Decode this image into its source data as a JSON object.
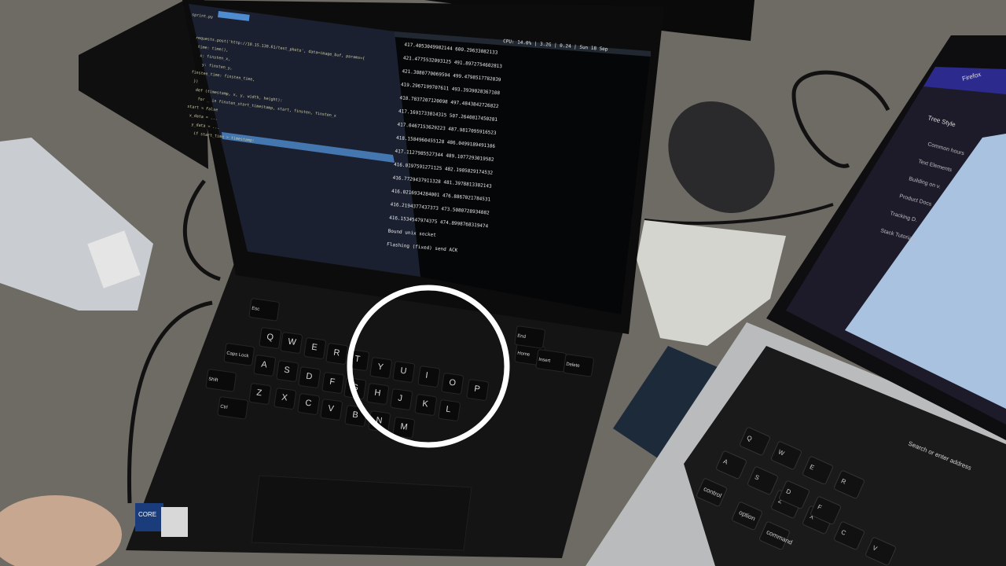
{
  "scene": {
    "description_label": "Photo of a laptop with a terminal and code editor open, beside a MacBook",
    "colors": {
      "carpet": "#6e6a64",
      "laptop": "#141414",
      "editor_bg": "#1b2030",
      "terminal_bg": "#050608",
      "selection": "#4f8ccf",
      "highlight_circle": "#ffffff",
      "macbook": "#b9bbbd",
      "firefox_sidebar": "#1d1b2a",
      "firefox_page": "#a9c2e0"
    }
  },
  "lenovo_screen": {
    "editor_tab": "sprint.py",
    "editor_lines": [
      "requests.post('http://10.15.130.61/test_photo', data=image_buf, params={",
      "    time: time(),",
      "    x: finsten_x,",
      "    y: finsten_y,",
      "    finsten_time: finsten_time,",
      "})",
      "def (timestamp, x, y, width, height):",
      "    for _ in finsten_start_timestamp, start, finsten, finsten_x",
      "        start = False",
      "        x_data = ...",
      "        y_data = ...",
      "    if start_time > timestamp:"
    ],
    "status_bar": "CPU: 14.0% | 3.2G | 0.24 | Sun 18 Sep",
    "terminal_lines": [
      "417.4053049982144 600.29633082133",
      "421.4775532093125 491.8972754602813",
      "421.3880770069594 499.4798517782039",
      "419.2967199707611 493.3939028367108",
      "418.7837207120098 497.4843842726822",
      "417.1691733014315 507.2640817450281",
      "417.0467153629223 487.9817095916523",
      "418.1584960455128 486.0499189491106",
      "417.1127985527344 489.1077293019582",
      "416.0197591271125 482.1905829174532",
      "416.7729437911328 481.3978813302143",
      "416.0216934284001 476.8867021784531",
      "416.2194377437373 473.5080728934082",
      "416.1534547974375 474.8998768319474",
      "Bound unix socket",
      "Flashing (fixed) send ACK"
    ]
  },
  "lenovo_keyboard": {
    "keys": [
      "Q",
      "W",
      "E",
      "R",
      "T",
      "Y",
      "U",
      "I",
      "O",
      "P",
      "A",
      "S",
      "D",
      "F",
      "G",
      "H",
      "J",
      "K",
      "L",
      "Z",
      "X",
      "C",
      "V",
      "B",
      "N",
      "M",
      "Esc",
      "Home",
      "End",
      "Insert",
      "Delete",
      "Caps Lock",
      "Shift",
      "Ctrl"
    ],
    "badge": "CORE"
  },
  "macbook": {
    "browser": "Firefox",
    "sidebar_title": "Tree Style",
    "sidebar_items": [
      "Common hours",
      "Text Elements",
      "Building on v.",
      "Product Docs",
      "Tracking D.",
      "Stack Tutorials"
    ],
    "address_placeholder": "Search or enter address",
    "keys": [
      "control",
      "option",
      "command",
      "Z",
      "X",
      "C",
      "V",
      "A",
      "S",
      "D",
      "F",
      "Q",
      "W",
      "E",
      "R"
    ]
  }
}
